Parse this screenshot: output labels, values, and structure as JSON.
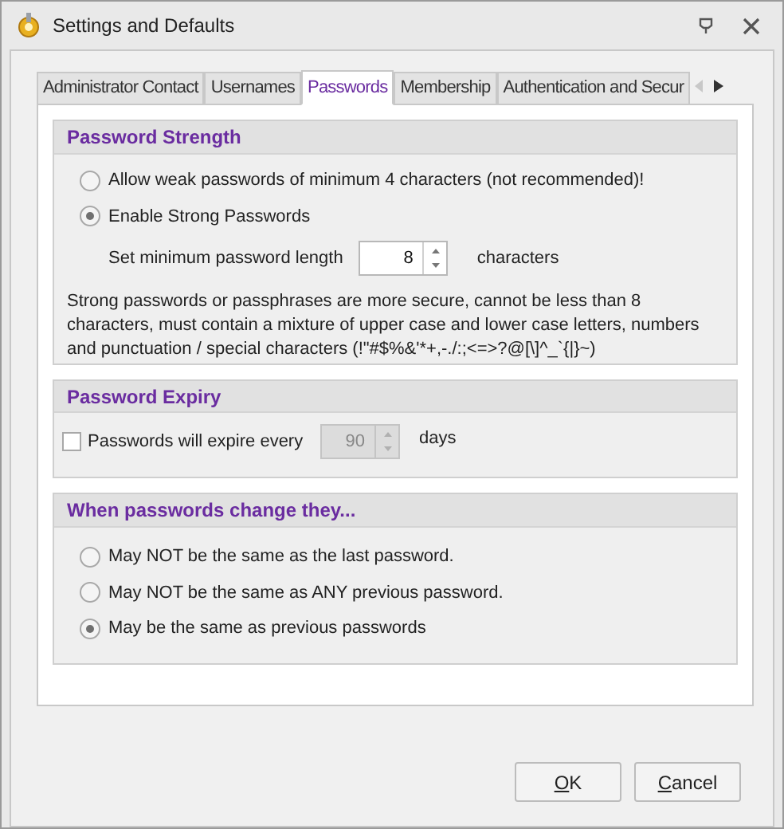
{
  "window": {
    "title": "Settings and Defaults"
  },
  "tabs": [
    {
      "label": "Administrator Contact",
      "selected": false
    },
    {
      "label": "Usernames",
      "selected": false
    },
    {
      "label": "Passwords",
      "selected": true
    },
    {
      "label": "Membership",
      "selected": false
    },
    {
      "label": "Authentication and Secur",
      "selected": false
    }
  ],
  "password_strength": {
    "title": "Password Strength",
    "options": [
      {
        "label": "Allow weak passwords of minimum 4 characters (not recommended)!",
        "selected": false
      },
      {
        "label": "Enable Strong Passwords",
        "selected": true
      }
    ],
    "min_length": {
      "label": "Set minimum password length",
      "value": "8",
      "unit": "characters",
      "disabled": false
    },
    "description": "Strong passwords or passphrases are more secure, cannot be less than 8 characters, must contain a mixture of upper case and lower case letters, numbers and punctuation / special characters (!\"#$%&'*+,-./:;<=>?@[\\]^_`{|}~)"
  },
  "password_expiry": {
    "title": "Password Expiry",
    "checkbox": {
      "label": "Passwords will expire every",
      "checked": false
    },
    "spin": {
      "value": "90",
      "unit": "days",
      "disabled": true
    }
  },
  "password_change": {
    "title": "When passwords change they...",
    "options": [
      {
        "label": "May NOT be the same as the last password.",
        "selected": false
      },
      {
        "label": "May NOT be the same as ANY previous password.",
        "selected": false
      },
      {
        "label": "May be the same as previous passwords",
        "selected": true
      }
    ]
  },
  "buttons": [
    {
      "label": "OK",
      "mnemonic": true
    },
    {
      "label": "Cancel",
      "mnemonic": true
    }
  ]
}
